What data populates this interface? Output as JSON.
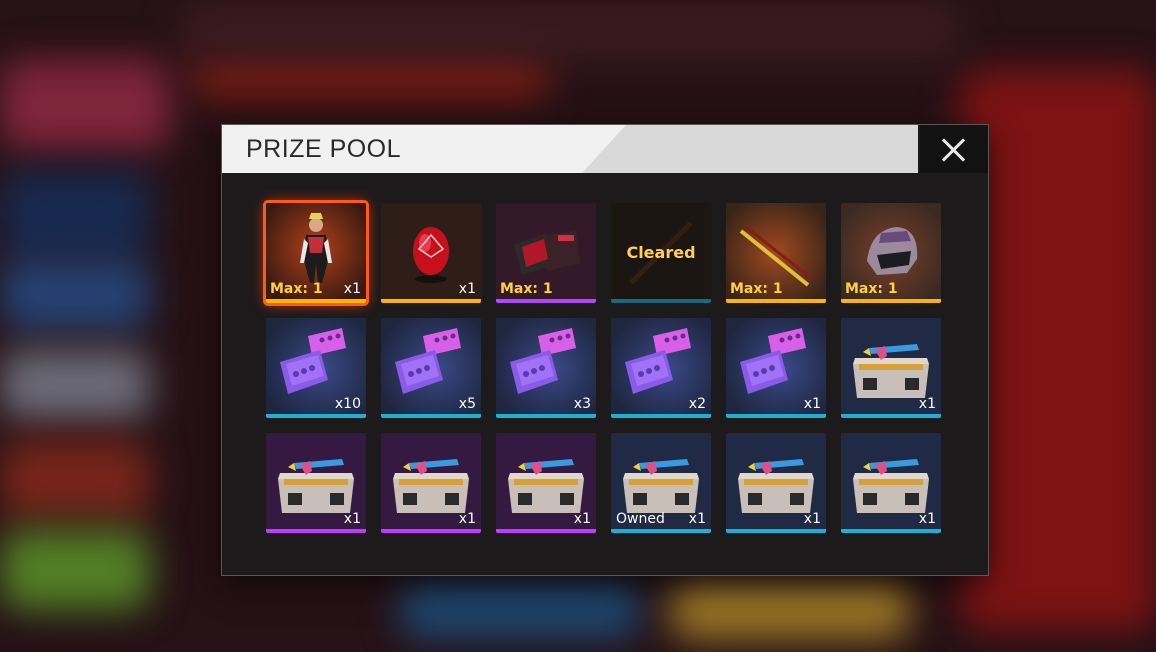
{
  "modal": {
    "title": "PRIZE POOL",
    "close_icon": "close-icon"
  },
  "items": [
    {
      "kind": "character",
      "max": "Max: 1",
      "qty": "x1",
      "bar": "#ffb400",
      "bg": "#3a1a12",
      "selected": true
    },
    {
      "kind": "egg",
      "max": "",
      "qty": "x1",
      "bar": "#ffb400",
      "bg": "#2f1e18"
    },
    {
      "kind": "bundle",
      "max": "Max: 1",
      "qty": "",
      "bar": "#b545ff",
      "bg": "#341a28"
    },
    {
      "kind": "cleared",
      "cleared": "Cleared",
      "qty": "",
      "bar": "#1a6a7e",
      "bg": "#3a2a22"
    },
    {
      "kind": "melee",
      "max": "Max: 1",
      "qty": "",
      "bar": "#ffb400",
      "bg": "#3a2418"
    },
    {
      "kind": "helmet",
      "max": "Max: 1",
      "qty": "",
      "bar": "#ffb400",
      "bg": "#3a2a22"
    },
    {
      "kind": "voucher",
      "qty": "x10",
      "bar": "#1ab0d8",
      "bg": "#202a45"
    },
    {
      "kind": "voucher",
      "qty": "x5",
      "bar": "#1ab0d8",
      "bg": "#202a45"
    },
    {
      "kind": "voucher",
      "qty": "x3",
      "bar": "#1ab0d8",
      "bg": "#202a45"
    },
    {
      "kind": "voucher",
      "qty": "x2",
      "bar": "#1ab0d8",
      "bg": "#202a45"
    },
    {
      "kind": "voucher",
      "qty": "x1",
      "bar": "#1ab0d8",
      "bg": "#202a45"
    },
    {
      "kind": "crate",
      "qty": "x1",
      "bar": "#1ab0d8",
      "bg": "#202a45"
    },
    {
      "kind": "crate",
      "qty": "x1",
      "bar": "#c23cff",
      "bg": "#341a40"
    },
    {
      "kind": "crate",
      "qty": "x1",
      "bar": "#c23cff",
      "bg": "#341a40"
    },
    {
      "kind": "crate",
      "qty": "x1",
      "bar": "#c23cff",
      "bg": "#341a40"
    },
    {
      "kind": "crate",
      "qty": "x1",
      "owned": "Owned",
      "bar": "#1ab0d8",
      "bg": "#202a45"
    },
    {
      "kind": "crate",
      "qty": "x1",
      "bar": "#1ab0d8",
      "bg": "#202a45"
    },
    {
      "kind": "crate",
      "qty": "x1",
      "bar": "#1ab0d8",
      "bg": "#202a45"
    }
  ]
}
